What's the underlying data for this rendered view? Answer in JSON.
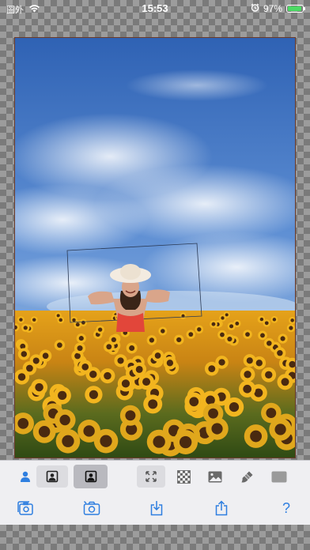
{
  "status_bar": {
    "carrier": "圖外",
    "time": "15:53",
    "battery_percent": "97%",
    "battery_level": 0.97
  },
  "canvas": {
    "background": "checkerboard",
    "photo_description_icon": "sunflower-field-photo",
    "frame_color": "#6b3a2a"
  },
  "toolbar": {
    "row1": [
      {
        "name": "person-mode-icon",
        "state": "active"
      },
      {
        "name": "portrait-frame-icon",
        "state": "boxed"
      },
      {
        "name": "portrait-frame-selected-icon",
        "state": "selected"
      },
      {
        "name": "fit-expand-icon",
        "state": "boxed"
      },
      {
        "name": "checkerboard-background-icon",
        "state": "normal"
      },
      {
        "name": "image-background-icon",
        "state": "normal"
      },
      {
        "name": "paint-brush-icon",
        "state": "normal"
      },
      {
        "name": "solid-color-background-icon",
        "state": "normal"
      }
    ],
    "row2": [
      {
        "name": "photo-library-icon"
      },
      {
        "name": "camera-icon"
      },
      {
        "name": "save-download-icon"
      },
      {
        "name": "share-icon"
      },
      {
        "name": "help-icon",
        "label": "?"
      }
    ],
    "accent_color": "#2f7fe0"
  }
}
